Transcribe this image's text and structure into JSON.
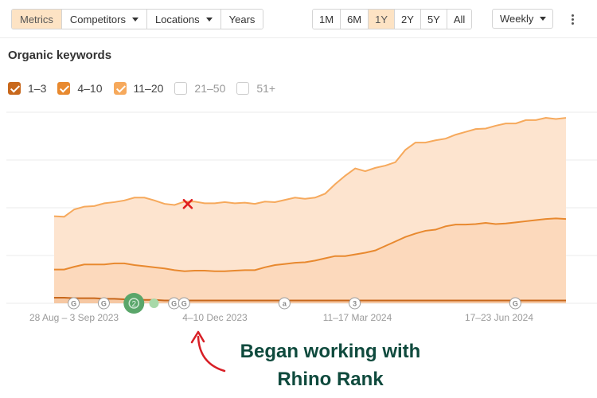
{
  "toolbar": {
    "tabs": [
      {
        "label": "Metrics",
        "active": true,
        "dropdown": false
      },
      {
        "label": "Competitors",
        "active": false,
        "dropdown": true
      },
      {
        "label": "Locations",
        "active": false,
        "dropdown": true
      },
      {
        "label": "Years",
        "active": false,
        "dropdown": false
      }
    ],
    "ranges": [
      {
        "label": "1M",
        "active": false
      },
      {
        "label": "6M",
        "active": false
      },
      {
        "label": "1Y",
        "active": true
      },
      {
        "label": "2Y",
        "active": false
      },
      {
        "label": "5Y",
        "active": false
      },
      {
        "label": "All",
        "active": false
      }
    ],
    "interval": "Weekly",
    "more_icon": "vertical-ellipsis-icon"
  },
  "section_title": "Organic keywords",
  "legend": [
    {
      "label": "1–3",
      "checked": true,
      "color": "#c8681c"
    },
    {
      "label": "4–10",
      "checked": true,
      "color": "#e8892f"
    },
    {
      "label": "11–20",
      "checked": true,
      "color": "#f6a95c"
    },
    {
      "label": "21–50",
      "checked": false,
      "color": "#ffffff"
    },
    {
      "label": "51+",
      "checked": false,
      "color": "#ffffff"
    }
  ],
  "chart_data": {
    "type": "area",
    "stacked": true,
    "grid": true,
    "y_axis_labels_shown": false,
    "x_tick_labels": [
      "28 Aug – 3 Sep 2023",
      "4–10 Dec 2023",
      "11–17 Mar 2024",
      "17–23 Jun 2024"
    ],
    "x": [
      0,
      1,
      2,
      3,
      4,
      5,
      6,
      7,
      8,
      9,
      10,
      11,
      12,
      13,
      14,
      15,
      16,
      17,
      18,
      19,
      20,
      21,
      22,
      23,
      24,
      25,
      26,
      27,
      28,
      29,
      30,
      31,
      32,
      33,
      34,
      35,
      36,
      37,
      38,
      39,
      40,
      41,
      42,
      43,
      44,
      45,
      46,
      47,
      48,
      49,
      50,
      51
    ],
    "series": [
      {
        "name": "1–3",
        "color": "#c8681c",
        "values": [
          10,
          10,
          9,
          9,
          9,
          8,
          8,
          7,
          7,
          6,
          6,
          5,
          5,
          5,
          5,
          5,
          5,
          5,
          5,
          5,
          5,
          5,
          5,
          5,
          5,
          5,
          5,
          5,
          5,
          5,
          5,
          5,
          5,
          5,
          5,
          5,
          5,
          5,
          5,
          5,
          5,
          5,
          5,
          5,
          5,
          5,
          5,
          5,
          5,
          5,
          5,
          5
        ]
      },
      {
        "name": "4–10",
        "color": "#e8892f",
        "values": [
          60,
          60,
          65,
          69,
          69,
          69,
          71,
          71,
          68,
          66,
          64,
          62,
          59,
          57,
          58,
          58,
          57,
          57,
          58,
          59,
          59,
          64,
          68,
          70,
          72,
          73,
          76,
          80,
          84,
          84,
          87,
          90,
          94,
          102,
          110,
          118,
          124,
          129,
          131,
          137,
          140,
          140,
          141,
          143,
          141,
          142,
          144,
          146,
          148,
          150,
          151,
          150
        ]
      },
      {
        "name": "11–20",
        "color": "#f6a95c",
        "values": [
          155,
          154,
          167,
          172,
          173,
          178,
          180,
          183,
          188,
          188,
          183,
          177,
          175,
          181,
          181,
          178,
          178,
          180,
          178,
          179,
          177,
          181,
          180,
          184,
          188,
          186,
          188,
          195,
          212,
          227,
          240,
          235,
          241,
          245,
          251,
          273,
          286,
          286,
          290,
          293,
          300,
          305,
          310,
          311,
          316,
          320,
          320,
          326,
          326,
          330,
          328,
          330
        ]
      }
    ],
    "markers": [
      {
        "label": "G",
        "x": 1
      },
      {
        "label": "G",
        "x": 4
      },
      {
        "label": "2",
        "x": 7,
        "style": "cluster"
      },
      {
        "label": "",
        "x": 9,
        "style": "dot"
      },
      {
        "label": "G",
        "x": 11
      },
      {
        "label": "G",
        "x": 12
      },
      {
        "label": "a",
        "x": 22
      },
      {
        "label": "3",
        "x": 29
      },
      {
        "label": "G",
        "x": 45
      }
    ],
    "annotation_mark": {
      "symbol": "x",
      "color": "#e01e1e",
      "series": "11–20",
      "x": 13
    }
  },
  "annotation": {
    "line1": "Began working with",
    "line2": "Rhino Rank",
    "color": "#0f4a3d",
    "arrow_color": "#d81f26"
  }
}
